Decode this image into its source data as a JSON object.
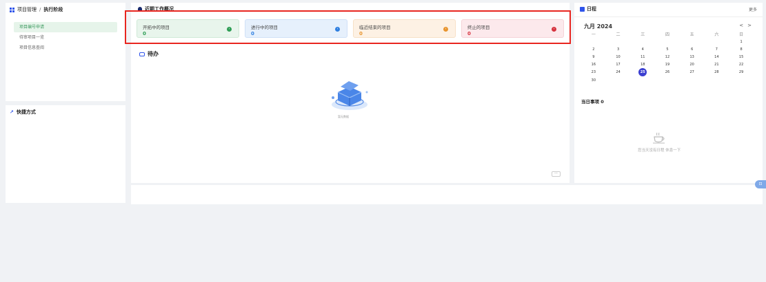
{
  "breadcrumb": {
    "root": "项目管理",
    "separator": "/",
    "current": "执行阶段"
  },
  "left_menu": {
    "items": [
      {
        "label": "项目编号申请"
      },
      {
        "label": "待审项目一览"
      },
      {
        "label": "项目信息查阅"
      }
    ]
  },
  "shortcuts": {
    "title": "快捷方式"
  },
  "work_overview": {
    "title": "近期工作概况",
    "cards": [
      {
        "label": "开拓中的项目",
        "count": "0",
        "color": "#2e9e55"
      },
      {
        "label": "进行中的项目",
        "count": "0",
        "color": "#2f7fe0"
      },
      {
        "label": "临近结束的项目",
        "count": "0",
        "color": "#e8952f"
      },
      {
        "label": "终止的项目",
        "count": "0",
        "color": "#d6323e"
      }
    ]
  },
  "todo": {
    "title": "待办",
    "empty_text": "暂无数据",
    "more_label": "···"
  },
  "calendar": {
    "title": "日程",
    "more": "更多",
    "month": "九月 2024",
    "prev": "<",
    "next": ">",
    "weekdays": [
      "一",
      "二",
      "三",
      "四",
      "五",
      "六",
      "日"
    ],
    "weeks": [
      [
        "",
        "",
        "",
        "",
        "",
        "",
        "1"
      ],
      [
        "2",
        "3",
        "4",
        "5",
        "6",
        "7",
        "8"
      ],
      [
        "9",
        "10",
        "11",
        "12",
        "13",
        "14",
        "15"
      ],
      [
        "16",
        "17",
        "18",
        "19",
        "20",
        "21",
        "22"
      ],
      [
        "23",
        "24",
        "25",
        "26",
        "27",
        "28",
        "29"
      ],
      [
        "30",
        "",
        "",
        "",
        "",
        "",
        ""
      ]
    ],
    "today": "25",
    "events_title": "当日事项",
    "events_count": "0",
    "empty_text": "您当天没有日程 休息一下"
  },
  "side_button": "⊡"
}
